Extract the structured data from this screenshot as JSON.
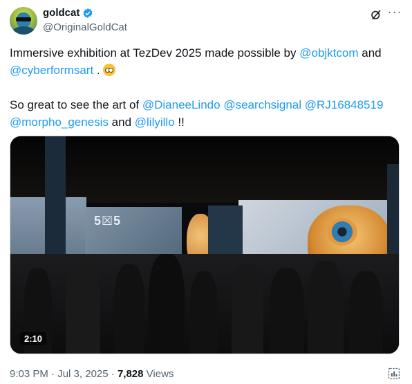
{
  "author": {
    "name": "goldcat",
    "handle": "@OriginalGoldCat",
    "verified": true
  },
  "tweet": {
    "line1_prefix": "Immersive exhibition at TezDev 2025 made possible by ",
    "mention_objkt": "@objktcom",
    "line1_and": " and",
    "mention_cyberforms": "@cyberformsart",
    "line1_suffix": " . ",
    "line2_prefix": "So great to see the art of ",
    "mention_diane": "@DianeeLindo",
    "mention_search": "@searchsignal",
    "mention_rj": "@RJ16848519",
    "mention_morpho": "@morpho_genesis",
    "line2_and": " and ",
    "mention_lily": "@lilyillo",
    "line2_suffix": " !!"
  },
  "media": {
    "duration": "2:10",
    "logo_text": "5☒5"
  },
  "meta": {
    "time": "9:03 PM",
    "date": "Jul 3, 2025",
    "views_count": "7,828",
    "views_label": "Views"
  },
  "icons": {
    "verified": "verified-badge-icon",
    "grok": "grok-icon",
    "more": "more-icon",
    "emoji": "pleading-face-emoji",
    "analytics": "post-analytics-icon"
  },
  "colors": {
    "link": "#1d9bf0",
    "text": "#0f1419",
    "secondary": "#536471"
  }
}
